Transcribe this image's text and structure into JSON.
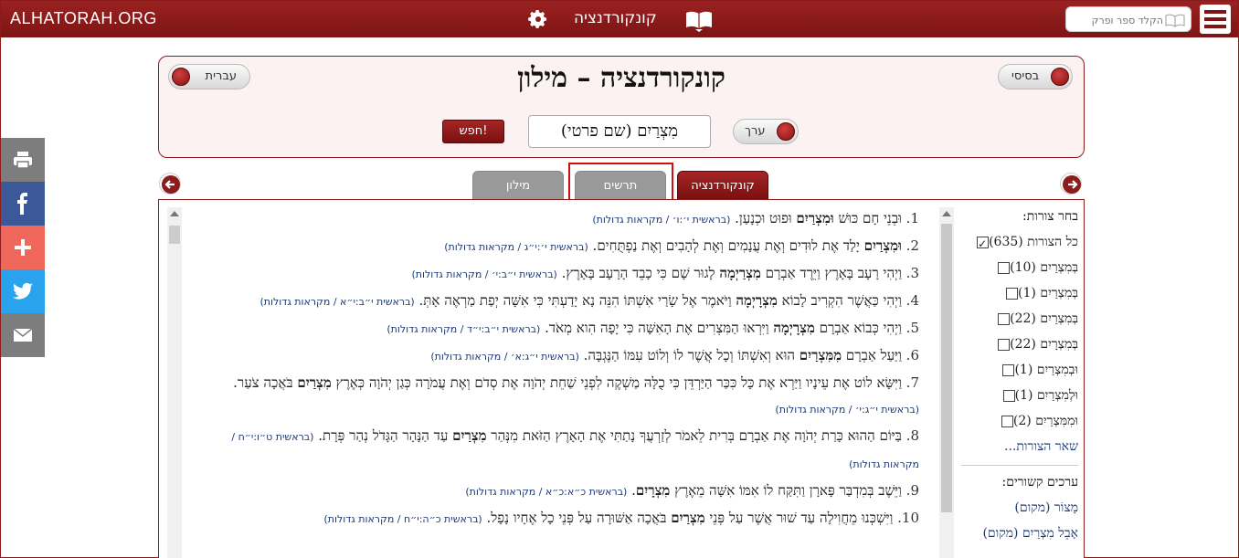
{
  "topbar": {
    "brand": "ALHATORAH.ORG",
    "title": "קונקורדנציה",
    "search_placeholder": "הקלד ספר ופרק"
  },
  "header": {
    "title": "קונקורדנציה – מילון",
    "lang_toggle": "עברית",
    "mode_toggle": "בסיסי",
    "entry_toggle": "ערך",
    "term": "מִצְרַיִם (שם פרטי)",
    "search_button": "חפש!"
  },
  "tabs": [
    {
      "label": "מילון"
    },
    {
      "label": "תרשים"
    },
    {
      "label": "קונקורדנציה"
    }
  ],
  "results": [
    {
      "num": "1.",
      "pre": "וּבְנֵי חָם כּוּשׁ ",
      "bold": "וּמִצְרַיִם",
      "post": " וּפוּט וּכְנָעַן.",
      "ref": "(בראשית י׳:ו׳ / מקראות גדולות)"
    },
    {
      "num": "2.",
      "pre": "",
      "bold": "וּמִצְרַיִם",
      "post": " יָלַד אֶת לוּדִים וְאֶת עֲנָמִים וְאֶת לְהָבִים וְאֶת נַפְתֻּחִים.",
      "ref": "(בראשית י׳:י״ג / מקראות גדולות)"
    },
    {
      "num": "3.",
      "pre": "וַיְהִי רָעָב בָּאָרֶץ וַיֵּרֶד אַבְרָם ",
      "bold": "מִצְרַיְמָה",
      "post": " לָגוּר שָׁם כִּי כָבֵד הָרָעָב בָּאָרֶץ.",
      "ref": "(בראשית י״ב:י׳ / מקראות גדולות)"
    },
    {
      "num": "4.",
      "pre": "וַיְהִי כַּאֲשֶׁר הִקְרִיב לָבוֹא ",
      "bold": "מִצְרָיְמָה",
      "post": " וַיֹּאמֶר אֶל שָׂרַי אִשְׁתּוֹ הִנֵּה נָא יָדַעְתִּי כִּי אִשָּׁה יְפַת מַרְאֶה אָתְּ.",
      "ref": "(בראשית י״ב:י״א / מקראות גדולות)"
    },
    {
      "num": "5.",
      "pre": "וַיְהִי כְּבוֹא אַבְרָם ",
      "bold": "מִצְרָיְמָה",
      "post": " וַיִּרְאוּ הַמִּצְרִים אֶת הָאִשָּׁה כִּי יָפָה הִוא מְאֹד.",
      "ref": "(בראשית י״ב:י״ד / מקראות גדולות)"
    },
    {
      "num": "6.",
      "pre": "וַיַּעַל אַבְרָם ",
      "bold": "מִמִּצְרַיִם",
      "post": " הוּא וְאִשְׁתּוֹ וְכָל אֲשֶׁר לוֹ וְלוֹט עִמּוֹ הַנֶּגְבָּה.",
      "ref": "(בראשית י״ג:א׳ / מקראות גדולות)"
    },
    {
      "num": "7.",
      "pre": "וַיִּשָּׂא לוֹט אֶת עֵינָיו וַיַּרְא אֶת כָּל כִּכַּר הַיַּרְדֵּן כִּי כֻלָּהּ מַשְׁקֶה לִפְנֵי שַׁחֵת יְהֹוָה אֶת סְדֹם וְאֶת עֲמֹרָה כְּגַן יְהֹוָה כְּאֶרֶץ ",
      "bold": "מִצְרַיִם",
      "post": " בֹּאֲכָה צֹעַר.",
      "ref": "(בראשית י״ג:י׳ / מקראות גדולות)"
    },
    {
      "num": "8.",
      "pre": "בַּיּוֹם הַהוּא כָּרַת יְהֹוָה אֶת אַבְרָם בְּרִית לֵאמֹר לְזַרְעֲךָ נָתַתִּי אֶת הָאָרֶץ הַזֹּאת מִנְּהַר ",
      "bold": "מִצְרַיִם",
      "post": " עַד הַנָּהָר הַגָּדֹל נְהַר פְּרָת.",
      "ref": "(בראשית ט״ו:י״ח / מקראות גדולות)"
    },
    {
      "num": "9.",
      "pre": "וַיֵּשֶׁב בְּמִדְבַּר פָּארָן וַתִּקַּח לוֹ אִמּוֹ אִשָּׁה מֵאֶרֶץ ",
      "bold": "מִצְרָיִם",
      "post": ".",
      "ref": "(בראשית כ״א:כ״א / מקראות גדולות)"
    },
    {
      "num": "10.",
      "pre": "וַיִּשְׁכְּנוּ מֵחֲוִילָה עַד שׁוּר אֲשֶׁר עַל פְּנֵי ",
      "bold": "מִצְרַיִם",
      "post": " בֹּאֲכָה אַשּׁוּרָה עַל פְּנֵי כָל אֶחָיו נָפָל.",
      "ref": "(בראשית כ״ה:י״ח / מקראות גדולות)"
    }
  ],
  "filters": {
    "heading": "בחר צורות:",
    "items": [
      {
        "label": "כל הצורות (635)",
        "checked": true
      },
      {
        "label": "בְּמִצְרַיִם (10)",
        "checked": false
      },
      {
        "label": "בְּמִצְרַיִם (1)",
        "checked": false
      },
      {
        "label": "בְּמִצְרַיִם (22)",
        "checked": false
      },
      {
        "label": "בְּמִצְרָיִם (22)",
        "checked": false
      },
      {
        "label": "וּבְמִצְרַיִם (1)",
        "checked": false
      },
      {
        "label": "וּלְמִצְרַיִם (1)",
        "checked": false
      },
      {
        "label": "וּמִמִּצְרַיִם (2)",
        "checked": false
      }
    ],
    "more": "שאר הצורות...",
    "related_heading": "ערכים קשורים:",
    "related": [
      "מָצוֹר (מקום)",
      "אָבֵל מִצְרַיִם (מקום)"
    ]
  },
  "colors": {
    "brand": "#8c1c1c",
    "link": "#1a3a7a",
    "facebook": "#3b5998",
    "twitter": "#2aa3ef",
    "plus": "#f0675c"
  }
}
